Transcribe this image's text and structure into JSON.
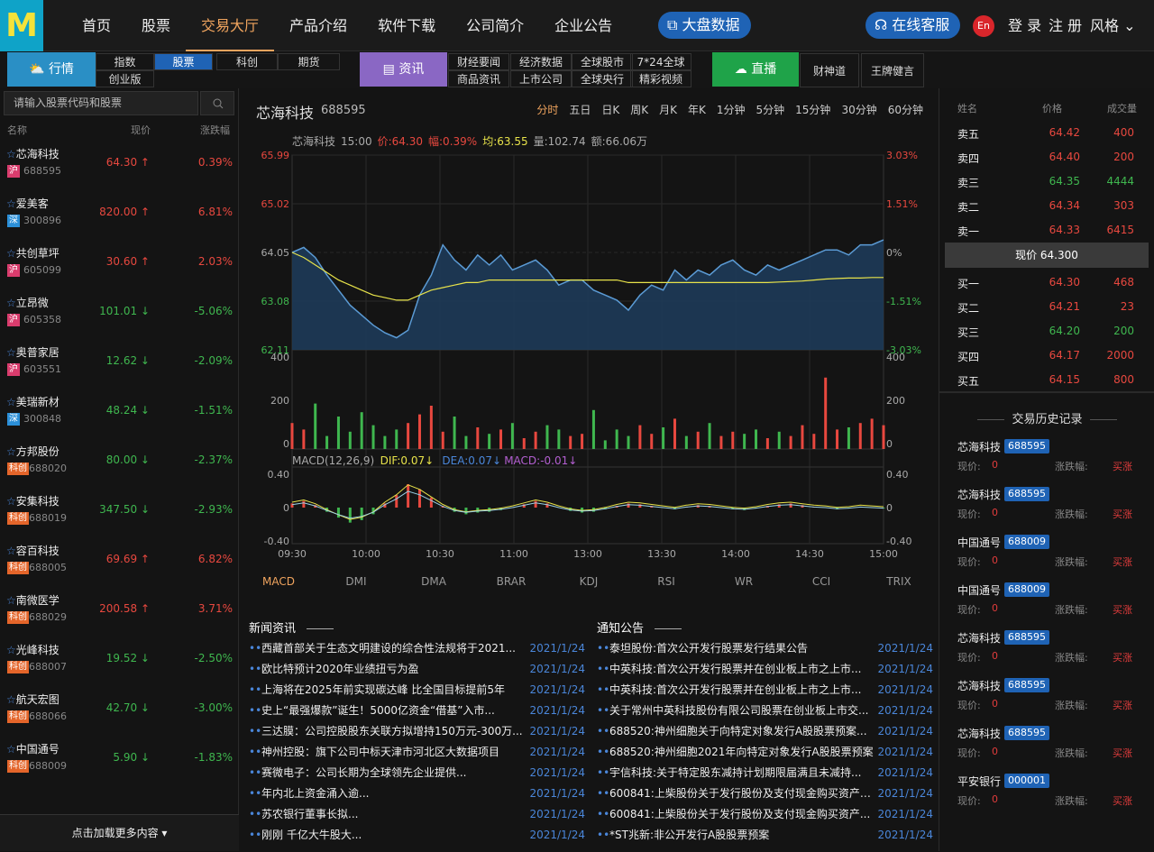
{
  "logo": {
    "letter": "M"
  },
  "nav": {
    "items": [
      "首页",
      "股票",
      "交易大厅",
      "产品介绍",
      "软件下载",
      "公司简介",
      "企业公告"
    ],
    "active": "交易大厅",
    "dapan": "大盘数据",
    "kefu": "在线客服",
    "lang": "En",
    "login": "登 录",
    "register": "注 册",
    "style": "风格"
  },
  "subnav": {
    "hangqing": "行情",
    "tabs": [
      [
        "指数",
        "股票",
        "科创",
        "期货"
      ],
      [
        "创业版"
      ]
    ],
    "active_tab": "股票",
    "zixun": "资讯",
    "zixun_links": [
      "财经要闻",
      "经济数据",
      "全球股市",
      "7*24全球",
      "商品资讯",
      "上市公司",
      "全球央行",
      "精彩视频"
    ],
    "zhibo": "直播",
    "zhibo_links": [
      "财神道",
      "王牌健言"
    ]
  },
  "left": {
    "search_placeholder": "请输入股票代码和股票",
    "col_name": "名称",
    "col_price": "现价",
    "col_change": "涨跌幅",
    "load_more": "点击加载更多内容",
    "stocks": [
      {
        "name": "芯海科技",
        "badge": "沪",
        "badge_color": "#d93c6d",
        "code": "688595",
        "price": "64.30",
        "arrow": "↑",
        "change": "0.39%",
        "dir": "up"
      },
      {
        "name": "爱美客",
        "badge": "深",
        "badge_color": "#2b8fd8",
        "code": "300896",
        "price": "820.00",
        "arrow": "↑",
        "change": "6.81%",
        "dir": "up"
      },
      {
        "name": "共创草坪",
        "badge": "沪",
        "badge_color": "#d93c6d",
        "code": "605099",
        "price": "30.60",
        "arrow": "↑",
        "change": "2.03%",
        "dir": "up"
      },
      {
        "name": "立昂微",
        "badge": "沪",
        "badge_color": "#d93c6d",
        "code": "605358",
        "price": "101.01",
        "arrow": "↓",
        "change": "-5.06%",
        "dir": "down"
      },
      {
        "name": "奥普家居",
        "badge": "沪",
        "badge_color": "#d93c6d",
        "code": "603551",
        "price": "12.62",
        "arrow": "↓",
        "change": "-2.09%",
        "dir": "down"
      },
      {
        "name": "美瑞新材",
        "badge": "深",
        "badge_color": "#2b8fd8",
        "code": "300848",
        "price": "48.24",
        "arrow": "↓",
        "change": "-1.51%",
        "dir": "down"
      },
      {
        "name": "方邦股份",
        "badge": "科创",
        "badge_color": "#e4652a",
        "code": "688020",
        "price": "80.00",
        "arrow": "↓",
        "change": "-2.37%",
        "dir": "down"
      },
      {
        "name": "安集科技",
        "badge": "科创",
        "badge_color": "#e4652a",
        "code": "688019",
        "price": "347.50",
        "arrow": "↓",
        "change": "-2.93%",
        "dir": "down"
      },
      {
        "name": "容百科技",
        "badge": "科创",
        "badge_color": "#e4652a",
        "code": "688005",
        "price": "69.69",
        "arrow": "↑",
        "change": "6.82%",
        "dir": "up"
      },
      {
        "name": "南微医学",
        "badge": "科创",
        "badge_color": "#e4652a",
        "code": "688029",
        "price": "200.58",
        "arrow": "↑",
        "change": "3.71%",
        "dir": "up"
      },
      {
        "name": "光峰科技",
        "badge": "科创",
        "badge_color": "#e4652a",
        "code": "688007",
        "price": "19.52",
        "arrow": "↓",
        "change": "-2.50%",
        "dir": "down"
      },
      {
        "name": "航天宏图",
        "badge": "科创",
        "badge_color": "#e4652a",
        "code": "688066",
        "price": "42.70",
        "arrow": "↓",
        "change": "-3.00%",
        "dir": "down"
      },
      {
        "name": "中国通号",
        "badge": "科创",
        "badge_color": "#e4652a",
        "code": "688009",
        "price": "5.90",
        "arrow": "↓",
        "change": "-1.83%",
        "dir": "down"
      }
    ]
  },
  "center": {
    "title": "芯海科技",
    "code": "688595",
    "periods": [
      "分时",
      "五日",
      "日K",
      "周K",
      "月K",
      "年K",
      "1分钟",
      "5分钟",
      "15分钟",
      "30分钟",
      "60分钟"
    ],
    "active_period": "分时",
    "info": [
      {
        "t": "芯海科技",
        "c": "#aaa"
      },
      {
        "t": "15:00",
        "c": "#aaa"
      },
      {
        "t": "价:64.30",
        "c": "#e8483f"
      },
      {
        "t": "幅:0.39%",
        "c": "#e8483f"
      },
      {
        "t": "均:63.55",
        "c": "#e8e34a"
      },
      {
        "t": "量:102.74",
        "c": "#aaa"
      },
      {
        "t": "额:66.06万",
        "c": "#aaa"
      }
    ],
    "macd_label": [
      {
        "t": "MACD(12,26,9)",
        "c": "#aaa"
      },
      {
        "t": "DIF:0.07↓",
        "c": "#e8e34a"
      },
      {
        "t": "DEA:0.07↓",
        "c": "#4a86d9"
      },
      {
        "t": "MACD:-0.01↓",
        "c": "#b35fd1"
      }
    ],
    "indicators": [
      "MACD",
      "DMI",
      "DMA",
      "BRAR",
      "KDJ",
      "RSI",
      "WR",
      "CCI",
      "TRIX"
    ],
    "active_indicator": "MACD"
  },
  "chart_data": {
    "type": "line",
    "title": "芯海科技 分时",
    "price_axis": [
      "65.99",
      "65.02",
      "64.05",
      "63.08",
      "62.11"
    ],
    "pct_axis": [
      "3.03%",
      "1.51%",
      "0%",
      "-1.51%",
      "-3.03%"
    ],
    "ylim": [
      62.11,
      65.99
    ],
    "prev_close": 64.05,
    "vol_axis": [
      "400",
      "200",
      "0"
    ],
    "macd_axis": [
      "0.40",
      "0",
      "-0.40"
    ],
    "x_ticks": [
      "09:30",
      "10:00",
      "10:30",
      "11:00",
      "13:00",
      "13:30",
      "14:00",
      "14:30",
      "15:00"
    ],
    "price": [
      64.05,
      64.15,
      63.95,
      63.6,
      63.3,
      63.0,
      62.8,
      62.6,
      62.45,
      62.35,
      62.5,
      63.2,
      63.6,
      64.2,
      63.9,
      63.7,
      64.0,
      63.8,
      64.0,
      63.7,
      63.8,
      63.9,
      63.7,
      63.4,
      63.5,
      63.5,
      63.3,
      63.2,
      63.1,
      62.9,
      63.2,
      63.4,
      63.3,
      63.7,
      63.5,
      63.7,
      63.6,
      63.8,
      63.9,
      63.7,
      63.6,
      63.8,
      63.7,
      63.8,
      63.9,
      64.0,
      64.1,
      64.1,
      64.0,
      64.2,
      64.2,
      64.3
    ],
    "avg": [
      64.05,
      63.95,
      63.8,
      63.65,
      63.5,
      63.4,
      63.3,
      63.2,
      63.15,
      63.1,
      63.1,
      63.2,
      63.3,
      63.35,
      63.4,
      63.45,
      63.45,
      63.5,
      63.5,
      63.5,
      63.5,
      63.5,
      63.5,
      63.5,
      63.5,
      63.5,
      63.5,
      63.5,
      63.5,
      63.45,
      63.45,
      63.45,
      63.45,
      63.45,
      63.45,
      63.45,
      63.45,
      63.45,
      63.45,
      63.45,
      63.45,
      63.45,
      63.46,
      63.47,
      63.48,
      63.5,
      63.52,
      63.53,
      63.54,
      63.54,
      63.55,
      63.55
    ],
    "volume": [
      120,
      90,
      210,
      60,
      150,
      80,
      170,
      110,
      60,
      90,
      120,
      160,
      200,
      80,
      150,
      60,
      100,
      70,
      90,
      120,
      50,
      80,
      110,
      90,
      60,
      70,
      180,
      40,
      90,
      60,
      110,
      70,
      100,
      140,
      60,
      80,
      120,
      60,
      80,
      70,
      90,
      50,
      80,
      60,
      110,
      70,
      330,
      90,
      100,
      120,
      140,
      110
    ],
    "macd": [
      0.05,
      0.08,
      0.03,
      -0.05,
      -0.12,
      -0.18,
      -0.15,
      -0.08,
      0.05,
      0.15,
      0.28,
      0.22,
      0.12,
      0.02,
      -0.05,
      -0.08,
      -0.06,
      -0.05,
      -0.03,
      0,
      0.04,
      0.08,
      0.05,
      0,
      -0.04,
      -0.06,
      -0.05,
      -0.02,
      0.02,
      0.05,
      0.04,
      0.02,
      0,
      -0.02,
      0.01,
      0.03,
      0.02,
      0,
      -0.02,
      -0.03,
      -0.01,
      0.02,
      0.04,
      0.05,
      0.03,
      0.01,
      0,
      -0.02,
      -0.01,
      0.01,
      0,
      -0.01
    ]
  },
  "news": {
    "title": "新闻资讯",
    "items": [
      {
        "t": "西藏首部关于生态文明建设的综合性法规将于2021...",
        "d": "2021/1/24"
      },
      {
        "t": "欧比特预计2020年业绩扭亏为盈",
        "d": "2021/1/24"
      },
      {
        "t": "上海将在2025年前实现碳达峰 比全国目标提前5年",
        "d": "2021/1/24"
      },
      {
        "t": "史上“最强爆款”诞生！5000亿资金“借基”入市...",
        "d": "2021/1/24"
      },
      {
        "t": "三达膜：公司控股股东关联方拟增持150万元-300万...",
        "d": "2021/1/24"
      },
      {
        "t": "神州控股：旗下公司中标天津市河北区大数据项目",
        "d": "2021/1/24"
      },
      {
        "t": "赛微电子：公司长期为全球领先企业提供...",
        "d": "2021/1/24"
      },
      {
        "t": "年内北上资金涌入逾...",
        "d": "2021/1/24"
      },
      {
        "t": "苏农银行董事长拟...",
        "d": "2021/1/24"
      },
      {
        "t": "刚刚 千亿大牛股大...",
        "d": "2021/1/24"
      }
    ]
  },
  "notice": {
    "title": "通知公告",
    "items": [
      {
        "t": "泰坦股份:首次公开发行股票发行结果公告",
        "d": "2021/1/24"
      },
      {
        "t": "中英科技:首次公开发行股票并在创业板上市之上市...",
        "d": "2021/1/24"
      },
      {
        "t": "中英科技:首次公开发行股票并在创业板上市之上市...",
        "d": "2021/1/24"
      },
      {
        "t": "关于常州中英科技股份有限公司股票在创业板上市交...",
        "d": "2021/1/24"
      },
      {
        "t": "688520:神州细胞关于向特定对象发行A股股票预案...",
        "d": "2021/1/24"
      },
      {
        "t": "688520:神州细胞2021年向特定对象发行A股股票预案",
        "d": "2021/1/24"
      },
      {
        "t": "宇信科技:关于特定股东减持计划期限届满且未减持...",
        "d": "2021/1/24"
      },
      {
        "t": "600841:上柴股份关于发行股份及支付现金购买资产并募...",
        "d": "2021/1/24"
      },
      {
        "t": "600841:上柴股份关于发行股份及支付现金购买资产...",
        "d": "2021/1/24"
      },
      {
        "t": "*ST兆新:非公开发行A股股票预案",
        "d": "2021/1/24"
      }
    ]
  },
  "orderbook": {
    "col_name": "姓名",
    "col_price": "价格",
    "col_vol": "成交量",
    "asks": [
      {
        "n": "卖五",
        "p": "64.42",
        "v": "400",
        "pc": "#e8483f",
        "vc": "#e8483f"
      },
      {
        "n": "卖四",
        "p": "64.40",
        "v": "200",
        "pc": "#e8483f",
        "vc": "#e8483f"
      },
      {
        "n": "卖三",
        "p": "64.35",
        "v": "4444",
        "pc": "#3fb74f",
        "vc": "#3fb74f"
      },
      {
        "n": "卖二",
        "p": "64.34",
        "v": "303",
        "pc": "#e8483f",
        "vc": "#e8483f"
      },
      {
        "n": "卖一",
        "p": "64.33",
        "v": "6415",
        "pc": "#e8483f",
        "vc": "#e8483f"
      }
    ],
    "current": "现价 64.300",
    "bids": [
      {
        "n": "买一",
        "p": "64.30",
        "v": "468",
        "pc": "#e8483f",
        "vc": "#e8483f"
      },
      {
        "n": "买二",
        "p": "64.21",
        "v": "23",
        "pc": "#e8483f",
        "vc": "#e8483f"
      },
      {
        "n": "买三",
        "p": "64.20",
        "v": "200",
        "pc": "#3fb74f",
        "vc": "#3fb74f"
      },
      {
        "n": "买四",
        "p": "64.17",
        "v": "2000",
        "pc": "#e8483f",
        "vc": "#e8483f"
      },
      {
        "n": "买五",
        "p": "64.15",
        "v": "800",
        "pc": "#e8483f",
        "vc": "#e8483f"
      }
    ]
  },
  "history": {
    "title": "交易历史记录",
    "price_label": "现价:",
    "change_label": "涨跌幅:",
    "items": [
      {
        "name": "芯海科技",
        "code": "688595",
        "price": "0",
        "change": "买涨"
      },
      {
        "name": "芯海科技",
        "code": "688595",
        "price": "0",
        "change": "买涨"
      },
      {
        "name": "中国通号",
        "code": "688009",
        "price": "0",
        "change": "买涨"
      },
      {
        "name": "中国通号",
        "code": "688009",
        "price": "0",
        "change": "买涨"
      },
      {
        "name": "芯海科技",
        "code": "688595",
        "price": "0",
        "change": "买涨"
      },
      {
        "name": "芯海科技",
        "code": "688595",
        "price": "0",
        "change": "买涨"
      },
      {
        "name": "芯海科技",
        "code": "688595",
        "price": "0",
        "change": "买涨"
      },
      {
        "name": "平安银行",
        "code": "000001",
        "price": "0",
        "change": "买涨"
      }
    ]
  },
  "colors": {
    "up": "#e8483f",
    "down": "#3fb74f",
    "accent": "#f0a45e",
    "blue": "#1f63b5",
    "price_line": "#5b9bd5",
    "avg_line": "#e8e34a"
  }
}
